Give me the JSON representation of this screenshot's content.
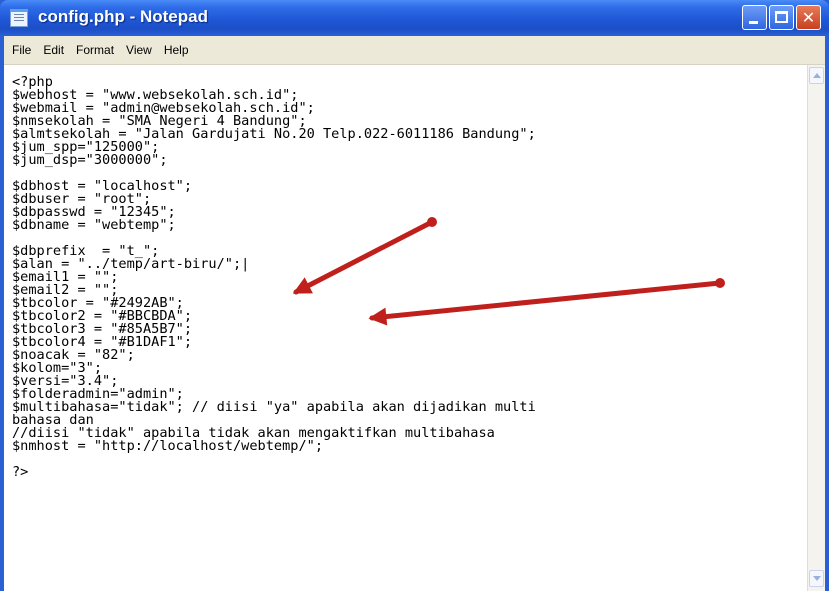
{
  "window": {
    "title": "config.php - Notepad",
    "controls": {
      "minimize_icon": "minimize-icon",
      "maximize_icon": "maximize-icon",
      "close_icon": "close-icon",
      "close_glyph": "✕"
    }
  },
  "menu": {
    "items": [
      "File",
      "Edit",
      "Format",
      "View",
      "Help"
    ]
  },
  "editor": {
    "lines": [
      "<?php",
      "$webhost = \"www.websekolah.sch.id\";",
      "$webmail = \"admin@websekolah.sch.id\";",
      "$nmsekolah = \"SMA Negeri 4 Bandung\";",
      "$almtsekolah = \"Jalan Gardujati No.20 Telp.022-6011186 Bandung\";",
      "$jum_spp=\"125000\";",
      "$jum_dsp=\"3000000\";",
      "",
      "$dbhost = \"localhost\";",
      "$dbuser = \"root\";",
      "$dbpasswd = \"12345\";",
      "$dbname = \"webtemp\";",
      "",
      "$dbprefix  = \"t_\";",
      "$alan = \"../temp/art-biru/\";|",
      "$email1 = \"\";",
      "$email2 = \"\";",
      "$tbcolor = \"#2492AB\";",
      "$tbcolor2 = \"#BBCBDA\";",
      "$tbcolor3 = \"#85A5B7\";",
      "$tbcolor4 = \"#B1DAF1\";",
      "$noacak = \"82\";",
      "$kolom=\"3\";",
      "$versi=\"3.4\";",
      "$folderadmin=\"admin\";",
      "$multibahasa=\"tidak\"; // diisi \"ya\" apabila akan dijadikan multi",
      "bahasa dan",
      "//diisi \"tidak\" apabila tidak akan mengaktifkan multibahasa",
      "$nmhost = \"http://localhost/webtemp/\";",
      "",
      "?>"
    ]
  },
  "annotations": {
    "arrow_color": "#c0201c"
  }
}
